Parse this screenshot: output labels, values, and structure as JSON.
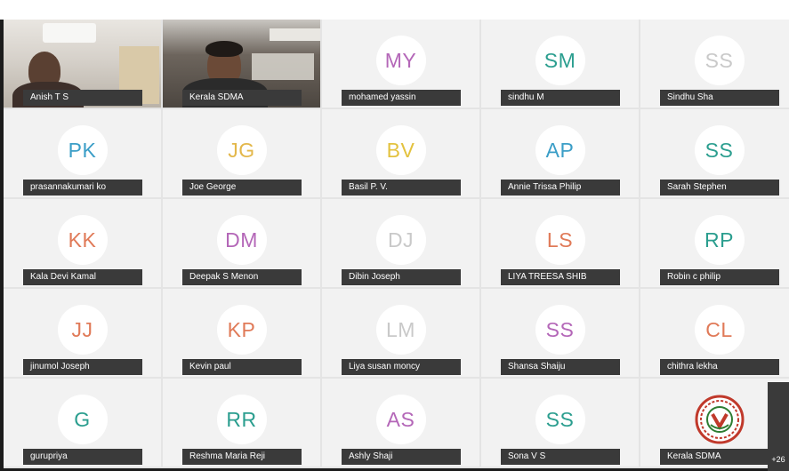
{
  "participants": [
    {
      "name": "Anish T S",
      "video": true
    },
    {
      "name": "Kerala SDMA",
      "video": true
    },
    {
      "name": "mohamed yassin",
      "initials": "MY",
      "color": "#b467b8"
    },
    {
      "name": "sindhu M",
      "initials": "SM",
      "color": "#2b9e8f"
    },
    {
      "name": "Sindhu Sha",
      "initials": "SS",
      "color": "#c9c9c9"
    },
    {
      "name": "prasannakumari ko",
      "initials": "PK",
      "color": "#3b9ec7"
    },
    {
      "name": "Joe George",
      "initials": "JG",
      "color": "#e3b74a"
    },
    {
      "name": "Basil P. V.",
      "initials": "BV",
      "color": "#e3c23f"
    },
    {
      "name": "Annie Trissa Philip",
      "initials": "AP",
      "color": "#3b9ec7"
    },
    {
      "name": "Sarah Stephen",
      "initials": "SS",
      "color": "#2b9e8f"
    },
    {
      "name": "Kala Devi Kamal",
      "initials": "KK",
      "color": "#e07a58"
    },
    {
      "name": "Deepak S Menon",
      "initials": "DM",
      "color": "#b467b8"
    },
    {
      "name": "Dibin Joseph",
      "initials": "DJ",
      "color": "#c9c9c9"
    },
    {
      "name": "LIYA TREESA SHIB",
      "initials": "LS",
      "color": "#e07a58"
    },
    {
      "name": "Robin c philip",
      "initials": "RP",
      "color": "#2b9e8f"
    },
    {
      "name": "jinumol Joseph",
      "initials": "JJ",
      "color": "#e07a58"
    },
    {
      "name": "Kevin paul",
      "initials": "KP",
      "color": "#e07a58"
    },
    {
      "name": "Liya susan moncy",
      "initials": "LM",
      "color": "#c9c9c9"
    },
    {
      "name": "Shansa Shaiju",
      "initials": "SS",
      "color": "#b467b8"
    },
    {
      "name": "chithra lekha",
      "initials": "CL",
      "color": "#e07a58"
    },
    {
      "name": "gurupriya",
      "initials": "G",
      "color": "#2b9e8f"
    },
    {
      "name": "Reshma Maria Reji",
      "initials": "RR",
      "color": "#2b9e8f"
    },
    {
      "name": "Ashly Shaji",
      "initials": "AS",
      "color": "#b467b8"
    },
    {
      "name": "Sona V S",
      "initials": "SS",
      "color": "#2b9e8f"
    },
    {
      "name": "Kerala SDMA",
      "logo": true
    }
  ],
  "more_participants_label": "+26"
}
